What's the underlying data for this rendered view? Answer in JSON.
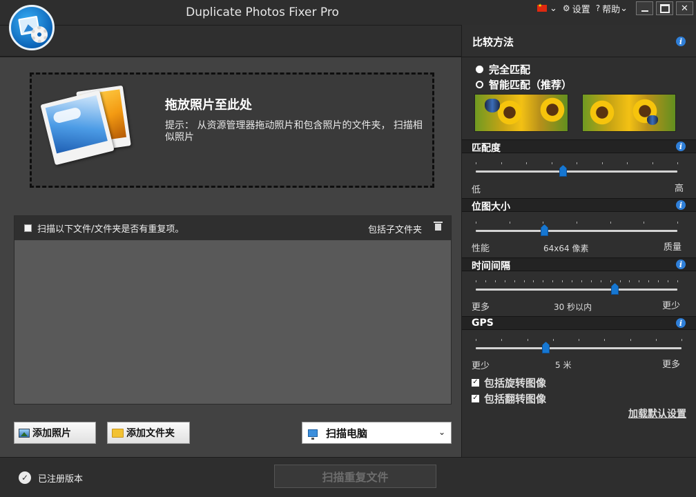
{
  "app": {
    "title": "Duplicate Photos Fixer Pro"
  },
  "titlebar": {
    "settings_label": "设置",
    "help_label": "帮助",
    "language_chevron": "⌄",
    "help_chevron": "⌄",
    "close_glyph": "✕"
  },
  "dropzone": {
    "title": "拖放照片至此处",
    "hint": "提示：  从资源管理器拖动照片和包含照片的文件夹， 扫描相似照片"
  },
  "folders": {
    "scan_check_label": "扫描以下文件/文件夹是否有重复项。",
    "include_subfolders_label": "包括子文件夹"
  },
  "buttons": {
    "add_photos": "添加照片",
    "add_folder": "添加文件夹",
    "scan_location": "扫描电脑",
    "scan_duplicates": "扫描重复文件"
  },
  "status": {
    "registered": "已注册版本"
  },
  "comparison": {
    "title": "比较方法",
    "exact_match": "完全匹配",
    "smart_match": "智能匹配（推荐）",
    "selected": "exact_match"
  },
  "match_level": {
    "title": "匹配度",
    "low": "低",
    "high": "高",
    "value_fraction": 0.43
  },
  "bitmap_size": {
    "title": "位图大小",
    "left": "性能",
    "right": "质量",
    "value_text": "64x64 像素",
    "value_fraction": 0.34
  },
  "time_interval": {
    "title": "时间间隔",
    "left": "更多",
    "right": "更少",
    "value_text": "30 秒以内",
    "value_fraction": 0.69
  },
  "gps": {
    "title": "GPS",
    "left": "更少",
    "right": "更多",
    "value_text": "5 米",
    "value_fraction": 0.34
  },
  "options": {
    "include_rotated": "包括旋转图像",
    "include_flipped": "包括翻转图像",
    "rotated_checked": true,
    "flipped_checked": true,
    "reset_defaults": "加载默认设置"
  },
  "colors": {
    "accent": "#1677d2",
    "info": "#2f7fd8"
  }
}
